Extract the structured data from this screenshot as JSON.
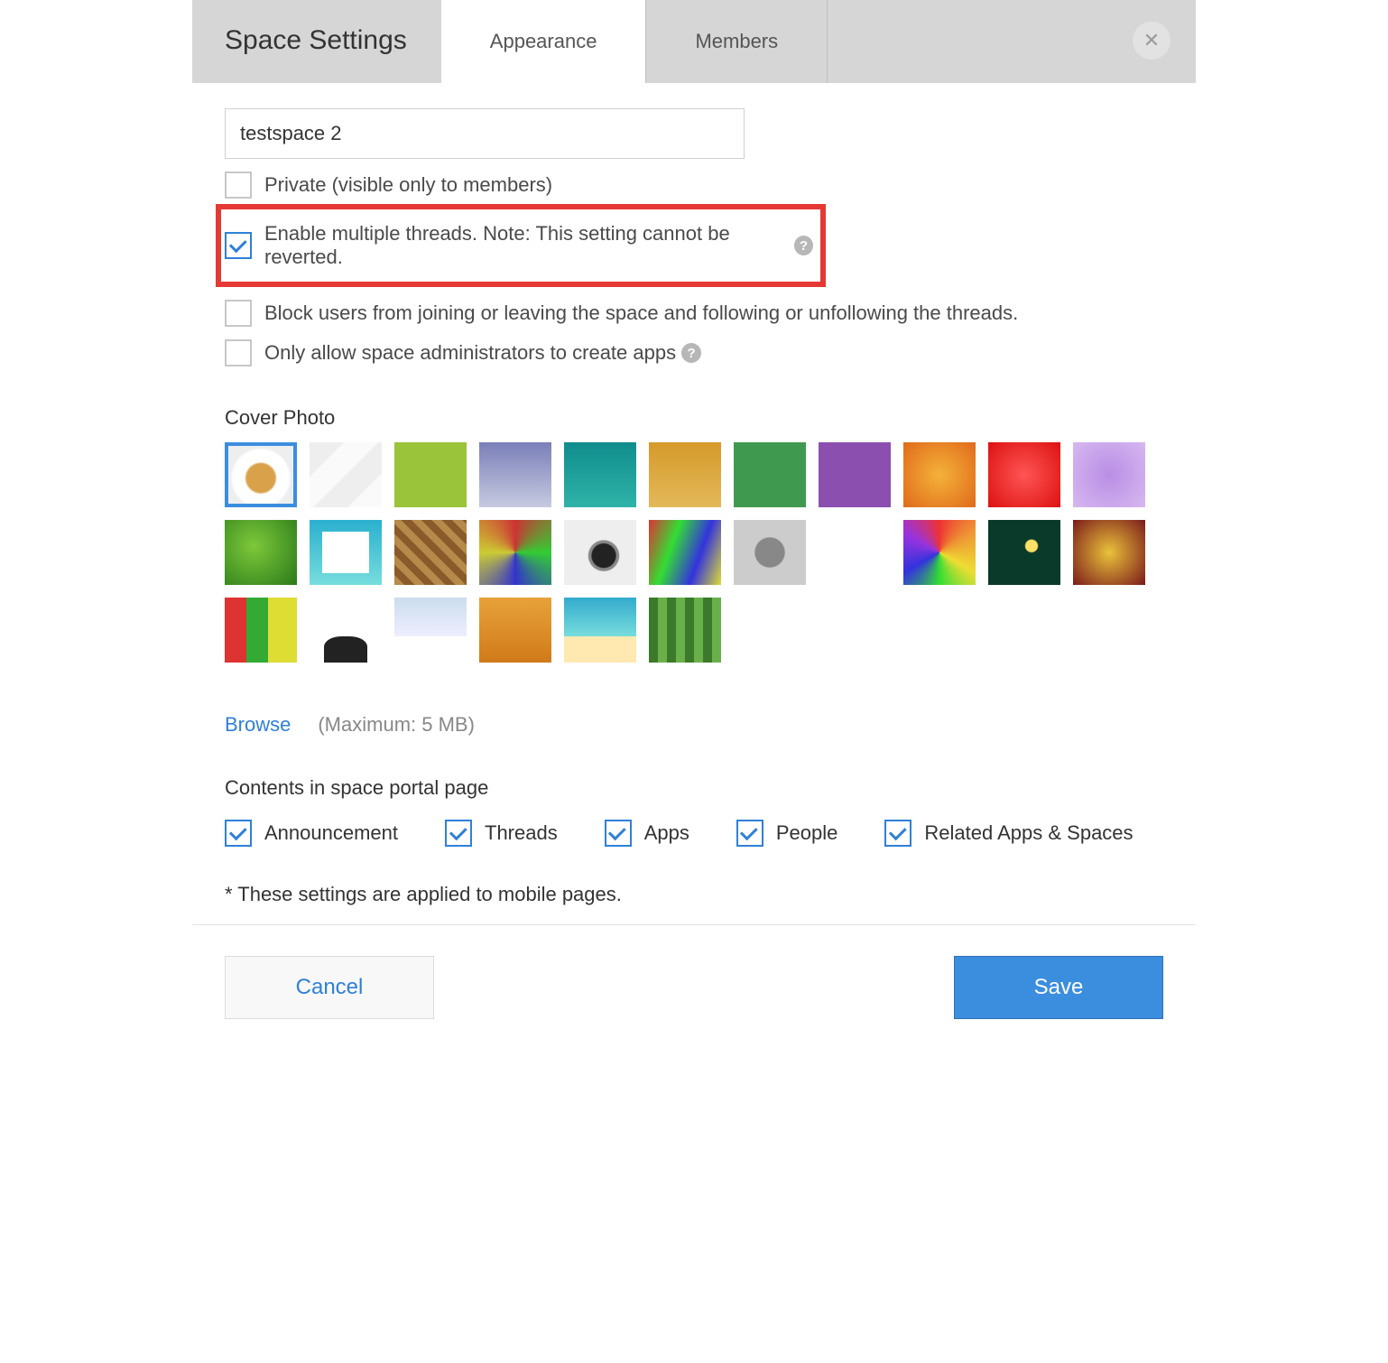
{
  "header": {
    "title": "Space Settings",
    "tabs": {
      "appearance": "Appearance",
      "members": "Members"
    }
  },
  "form": {
    "space_name": "testspace 2",
    "options": {
      "private": {
        "label": "Private (visible only to members)",
        "checked": false
      },
      "multithread": {
        "label": "Enable multiple threads. Note: This setting cannot be reverted.",
        "checked": true
      },
      "block_join": {
        "label": "Block users from joining or leaving the space and following or unfollowing the threads.",
        "checked": false
      },
      "admin_apps": {
        "label": "Only allow space administrators to create apps",
        "checked": false
      }
    },
    "cover_label": "Cover Photo",
    "browse": "Browse",
    "browse_hint": "(Maximum: 5 MB)",
    "portal_label": "Contents in space portal page",
    "portal": {
      "announcement": "Announcement",
      "threads": "Threads",
      "apps": "Apps",
      "people": "People",
      "related": "Related Apps & Spaces"
    },
    "mobile_note": "* These settings are applied to mobile pages."
  },
  "footer": {
    "cancel": "Cancel",
    "save": "Save"
  },
  "help_glyph": "?"
}
